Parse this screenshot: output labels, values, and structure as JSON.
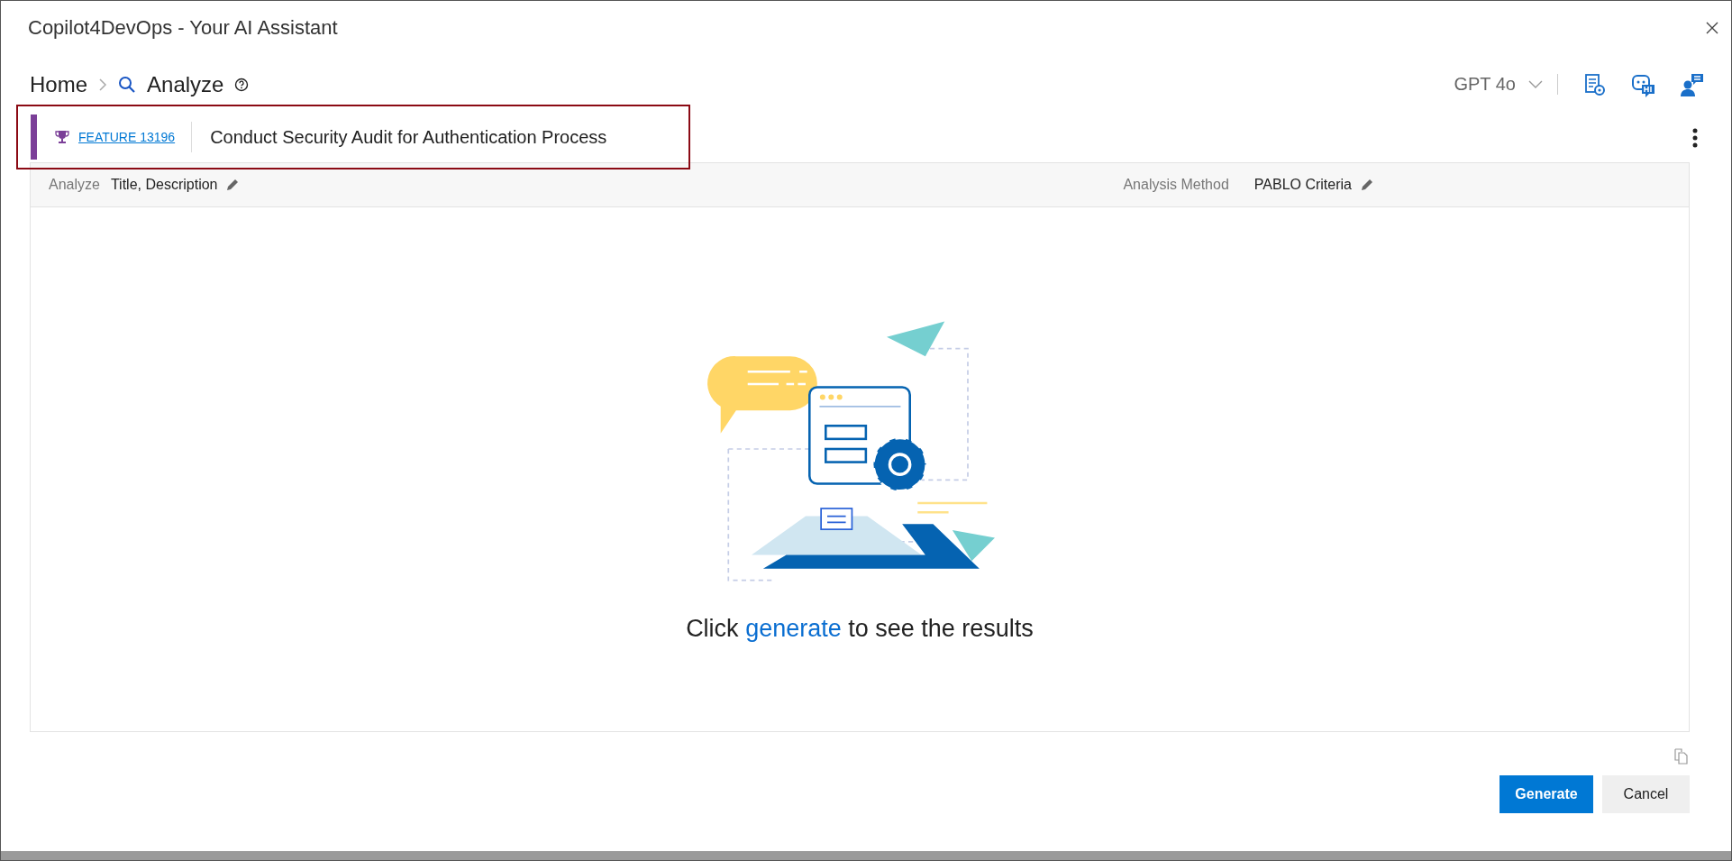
{
  "window": {
    "title": "Copilot4DevOps - Your AI Assistant"
  },
  "breadcrumb": {
    "home": "Home",
    "current": "Analyze"
  },
  "model": {
    "label": "GPT 4o"
  },
  "work_item": {
    "type": "FEATURE 13196",
    "title": "Conduct Security Audit for Authentication Process",
    "color": "#7b3f98"
  },
  "settings_bar": {
    "analyze_label": "Analyze",
    "analyze_value": "Title,  Description",
    "method_label": "Analysis Method",
    "method_value": "PABLO Criteria"
  },
  "empty_state": {
    "before": "Click",
    "link": "generate",
    "after": "to see the results"
  },
  "buttons": [
    {
      "label": "Generate",
      "kind": "primary"
    },
    {
      "label": "Cancel",
      "kind": "secondary"
    }
  ]
}
